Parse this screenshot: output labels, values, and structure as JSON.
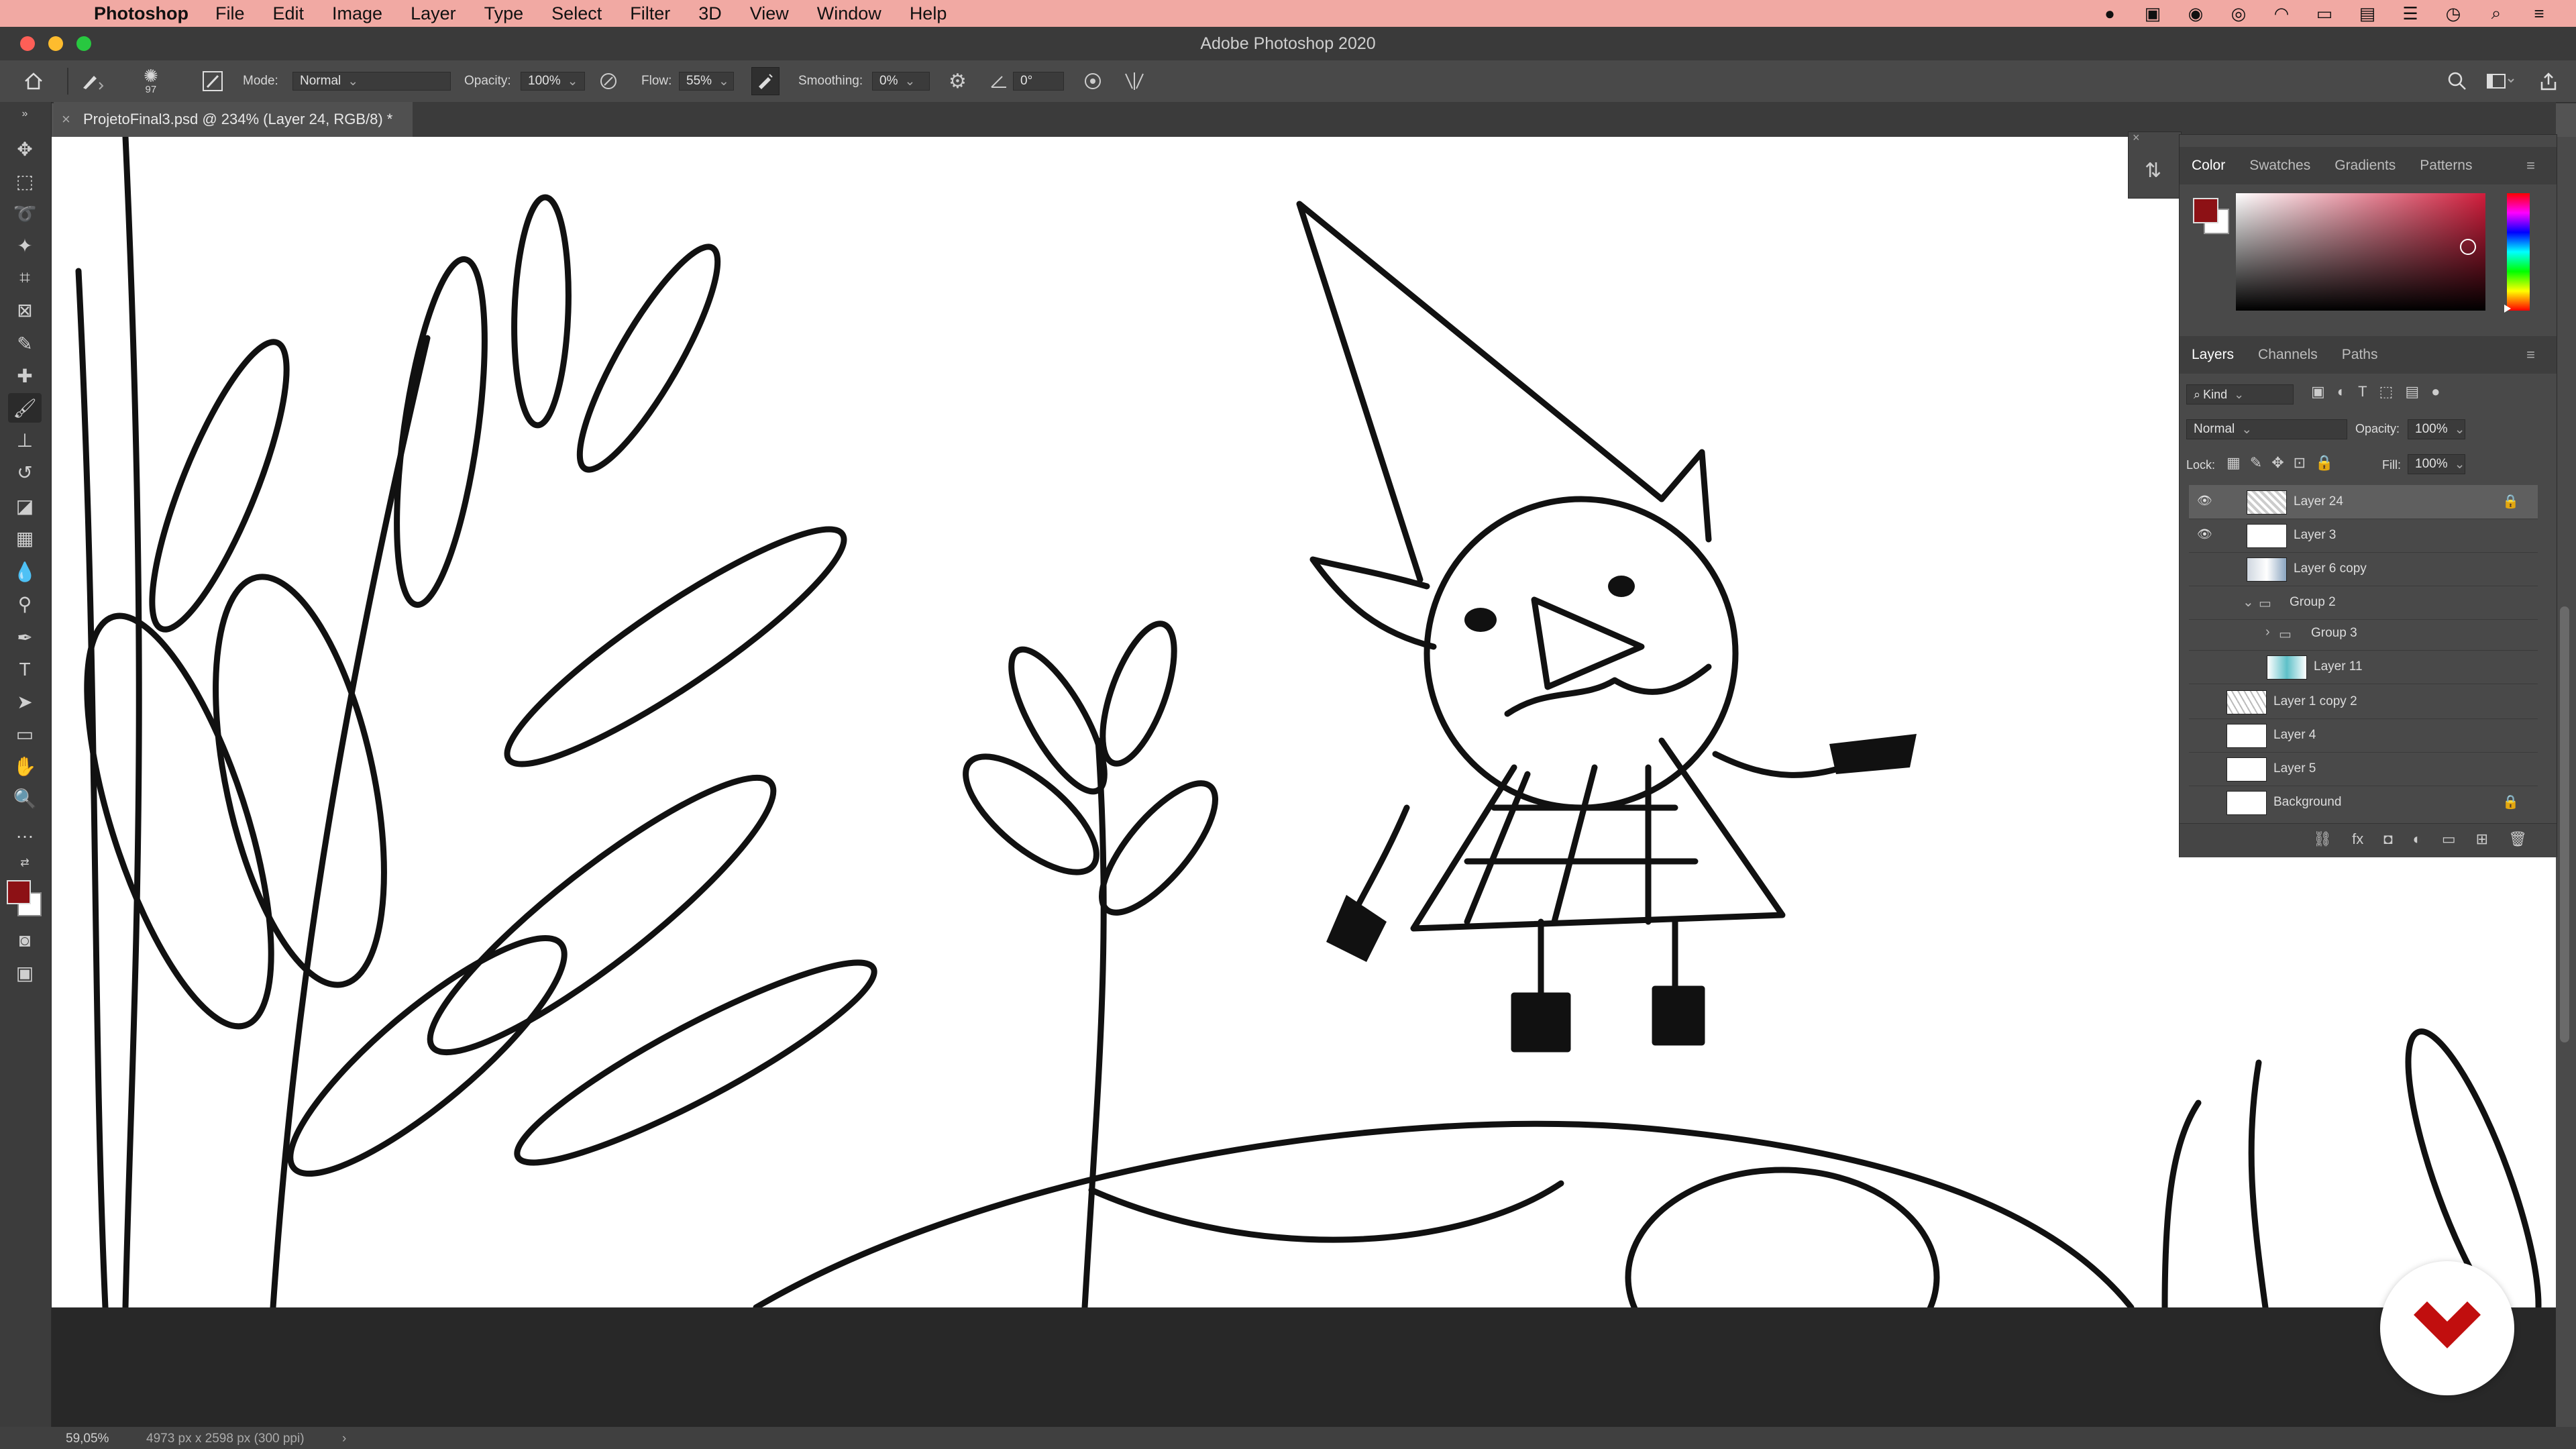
{
  "menubar": {
    "app_name": "Photoshop",
    "menus": [
      "File",
      "Edit",
      "Image",
      "Layer",
      "Type",
      "Select",
      "Filter",
      "3D",
      "View",
      "Window",
      "Help"
    ],
    "status_icons": [
      "cloud-icon",
      "creative-cloud-icon",
      "siri-icon",
      "eye-icon",
      "wifi-icon",
      "display-icon",
      "flag-icon",
      "menu-icon",
      "clock-icon",
      "search-icon",
      "control-center-icon"
    ]
  },
  "window": {
    "title": "Adobe Photoshop 2020"
  },
  "options_bar": {
    "brush_size": "97",
    "mode_label": "Mode:",
    "mode_value": "Normal",
    "opacity_label": "Opacity:",
    "opacity_value": "100%",
    "flow_label": "Flow:",
    "flow_value": "55%",
    "smoothing_label": "Smoothing:",
    "smoothing_value": "0%",
    "angle_value": "0°"
  },
  "document": {
    "tab_label": "ProjetoFinal3.psd @ 234% (Layer 24, RGB/8) *"
  },
  "color_panel": {
    "tabs": [
      "Color",
      "Swatches",
      "Gradients",
      "Patterns"
    ],
    "foreground_color": "#8d1115",
    "background_color": "#ffffff"
  },
  "layers_panel": {
    "tabs": [
      "Layers",
      "Channels",
      "Paths"
    ],
    "kind_filter": "Kind",
    "blend_mode": "Normal",
    "opacity_label": "Opacity:",
    "opacity_value": "100%",
    "lock_label": "Lock:",
    "fill_label": "Fill:",
    "fill_value": "100%",
    "layers": [
      {
        "name": "Layer 24",
        "visible": true,
        "locked": true,
        "selected": true
      },
      {
        "name": "Layer 3",
        "visible": true
      },
      {
        "name": "Layer 6 copy",
        "visible": false
      },
      {
        "name": "Group 2",
        "visible": false,
        "group": true,
        "expanded": true
      },
      {
        "name": "Group 3",
        "visible": false,
        "group": true
      },
      {
        "name": "Layer 11",
        "visible": false
      },
      {
        "name": "Layer 1 copy 2",
        "visible": false
      },
      {
        "name": "Layer 4",
        "visible": false
      },
      {
        "name": "Layer 5",
        "visible": false
      },
      {
        "name": "Background",
        "visible": false,
        "locked": true
      }
    ]
  },
  "status_bar": {
    "zoom": "59,05%",
    "doc_info": "4973 px x 2598 px (300 ppi)"
  }
}
